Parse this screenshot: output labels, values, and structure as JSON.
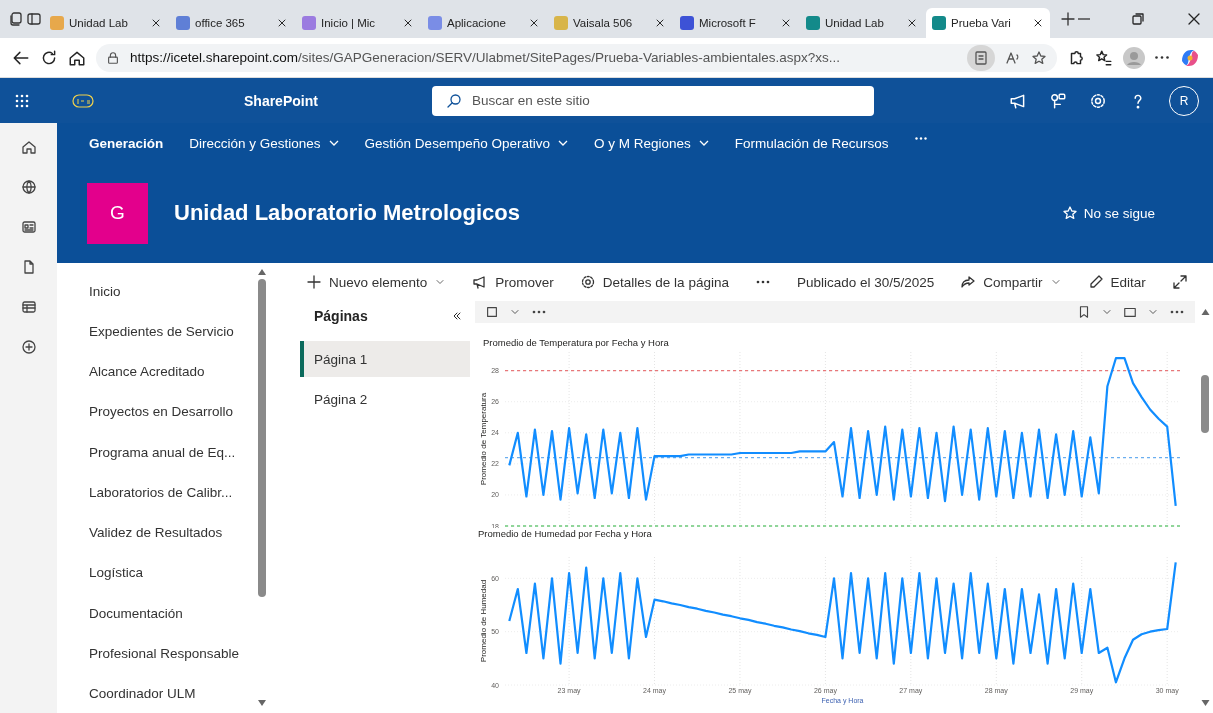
{
  "browser": {
    "tabs": [
      {
        "title": "Unidad Lab",
        "selected": false
      },
      {
        "title": "office 365",
        "selected": false
      },
      {
        "title": "Inicio | Mic",
        "selected": false
      },
      {
        "title": "Aplicacione",
        "selected": false
      },
      {
        "title": "Vaisala 506",
        "selected": false
      },
      {
        "title": "Microsoft F",
        "selected": false
      },
      {
        "title": "Unidad Lab",
        "selected": false
      },
      {
        "title": "Prueba Vari",
        "selected": true
      }
    ],
    "url": {
      "host": "https://icetel.sharepoint.com",
      "path": "/sites/GAPGeneracion/SERV/Ulabmet/SitePages/Prueba-Variables-ambientales.aspx?xs..."
    }
  },
  "suite_bar": {
    "app_name": "SharePoint",
    "search": {
      "placeholder": "Buscar en este sitio"
    },
    "avatar": "R"
  },
  "hub_nav": {
    "items": [
      {
        "label": "Generación",
        "selected": true,
        "has_menu": false
      },
      {
        "label": "Dirección y Gestiones",
        "selected": false,
        "has_menu": true
      },
      {
        "label": "Gestión Desempeño Operativo",
        "selected": false,
        "has_menu": true
      },
      {
        "label": "O y M Regiones",
        "selected": false,
        "has_menu": true
      },
      {
        "label": "Formulación de Recursos",
        "selected": false,
        "has_menu": false
      }
    ]
  },
  "site_header": {
    "logo_letter": "G",
    "title": "Unidad Laboratorio Metrologicos",
    "follow": "No se sigue"
  },
  "left_nav": {
    "items": [
      "Inicio",
      "Expedientes de Servicio",
      "Alcance Acreditado",
      "Proyectos en Desarrollo",
      "Programa anual de Eq...",
      "Laboratorios de Calibr...",
      "Validez de Resultados",
      "Logística",
      "Documentación",
      "Profesional Responsable",
      "Coordinador ULM"
    ]
  },
  "command_bar": {
    "items": [
      {
        "kind": "new",
        "label": "Nuevo elemento"
      },
      {
        "kind": "promote",
        "label": "Promover"
      },
      {
        "kind": "details",
        "label": "Detalles de la página"
      },
      {
        "kind": "more"
      },
      {
        "kind": "text",
        "label": "Publicado el 30/5/2025"
      },
      {
        "kind": "share",
        "label": "Compartir"
      },
      {
        "kind": "edit",
        "label": "Editar"
      },
      {
        "kind": "expand"
      }
    ]
  },
  "pages_panel": {
    "title": "Páginas",
    "items": [
      {
        "label": "Página 1",
        "selected": true
      },
      {
        "label": "Página 2",
        "selected": false
      }
    ]
  },
  "report": {
    "charts": [
      {
        "chart_data": {
          "type": "line",
          "title": "Promedio de Temperatura por Fecha y Hora",
          "ylabel": "Promedio de Temperatura",
          "ylim": [
            18,
            29.2
          ],
          "yticks": [
            18,
            20,
            22,
            24,
            26,
            28
          ],
          "categories": [
            null,
            null,
            null,
            null,
            null,
            null,
            null,
            null,
            null,
            null,
            null,
            null,
            null,
            null,
            null,
            null,
            null,
            null,
            null,
            null,
            null,
            null,
            null,
            null,
            null,
            null,
            null,
            null,
            null,
            null,
            null,
            null,
            null,
            null,
            null,
            null,
            null,
            null,
            null,
            null,
            null,
            null,
            null,
            null,
            null,
            null,
            null,
            null,
            null,
            null,
            null,
            null,
            null,
            null,
            null,
            null,
            null,
            null,
            null,
            null,
            null,
            null,
            null,
            null,
            null,
            null,
            null,
            null,
            null,
            null,
            null,
            null,
            null,
            null,
            null,
            null,
            null,
            null,
            null
          ],
          "grid": true,
          "series": [
            {
              "color": "#118dff",
              "values": [
                21.9,
                24.0,
                19.9,
                24.2,
                20.0,
                24.1,
                19.7,
                24.3,
                20.1,
                23.9,
                19.8,
                24.2,
                20.1,
                24.0,
                19.8,
                24.3,
                19.7,
                22.5,
                22.5,
                22.5,
                22.5,
                22.6,
                22.6,
                22.6,
                22.6,
                22.6,
                22.6,
                22.7,
                22.7,
                22.7,
                22.7,
                22.7,
                22.7,
                22.7,
                22.8,
                22.8,
                22.8,
                22.8,
                23.4,
                19.9,
                24.3,
                19.8,
                24.1,
                20.0,
                24.4,
                19.7,
                24.2,
                19.9,
                24.3,
                19.8,
                24.0,
                19.6,
                24.4,
                20.0,
                24.2,
                19.7,
                24.3,
                19.9,
                24.1,
                19.8,
                24.0,
                19.9,
                24.2,
                19.8,
                23.9,
                20.0,
                24.1,
                19.9,
                23.7,
                20.1,
                27.0,
                28.8,
                28.8,
                27.2,
                26.3,
                25.5,
                24.9,
                24.4,
                19.3
              ]
            }
          ],
          "ref_lines": [
            {
              "axis": "y",
              "value": 28,
              "color": "#e8777a"
            },
            {
              "axis": "y",
              "value": 22.4,
              "color": "#6aaef0"
            },
            {
              "axis": "y",
              "value": 18,
              "color": "#6cc97a"
            }
          ]
        }
      },
      {
        "chart_data": {
          "type": "line",
          "title": "Promedio de Humedad por Fecha y Hora",
          "xlabel": "Fecha y Hora",
          "ylabel": "Promedio de Humedad",
          "ylim": [
            40,
            64
          ],
          "yticks": [
            40,
            50,
            60
          ],
          "categories": [
            null,
            null,
            null,
            null,
            null,
            null,
            null,
            "23 may",
            null,
            null,
            null,
            null,
            null,
            null,
            null,
            null,
            null,
            "24 may",
            null,
            null,
            null,
            null,
            null,
            null,
            null,
            null,
            null,
            "25 may",
            null,
            null,
            null,
            null,
            null,
            null,
            null,
            null,
            null,
            "26 may",
            null,
            null,
            null,
            null,
            null,
            null,
            null,
            null,
            null,
            "27 may",
            null,
            null,
            null,
            null,
            null,
            null,
            null,
            null,
            null,
            "28 may",
            null,
            null,
            null,
            null,
            null,
            null,
            null,
            null,
            null,
            "29 may",
            null,
            null,
            null,
            null,
            null,
            null,
            null,
            null,
            null,
            "30 may",
            null
          ],
          "grid": true,
          "series": [
            {
              "color": "#118dff",
              "values": [
                52,
                58,
                46,
                59,
                45,
                60,
                44,
                61,
                46,
                62,
                45,
                60,
                46,
                61,
                45,
                60,
                49,
                56,
                55.7,
                55.3,
                55,
                54.6,
                54.3,
                53.9,
                53.6,
                53.2,
                52.9,
                52.5,
                52.2,
                51.8,
                51.5,
                51.1,
                50.8,
                50.4,
                50.1,
                49.7,
                49.4,
                49,
                60,
                45,
                61,
                46,
                60,
                45,
                61,
                44,
                60,
                46,
                61,
                45,
                60,
                46,
                59,
                45,
                61,
                46,
                59,
                45,
                58,
                44,
                58,
                46,
                57,
                44,
                58,
                45,
                59,
                46,
                58,
                46,
                47,
                40.5,
                45,
                48.5,
                49.5,
                50,
                50.3,
                50.5,
                63
              ]
            }
          ]
        }
      }
    ]
  }
}
